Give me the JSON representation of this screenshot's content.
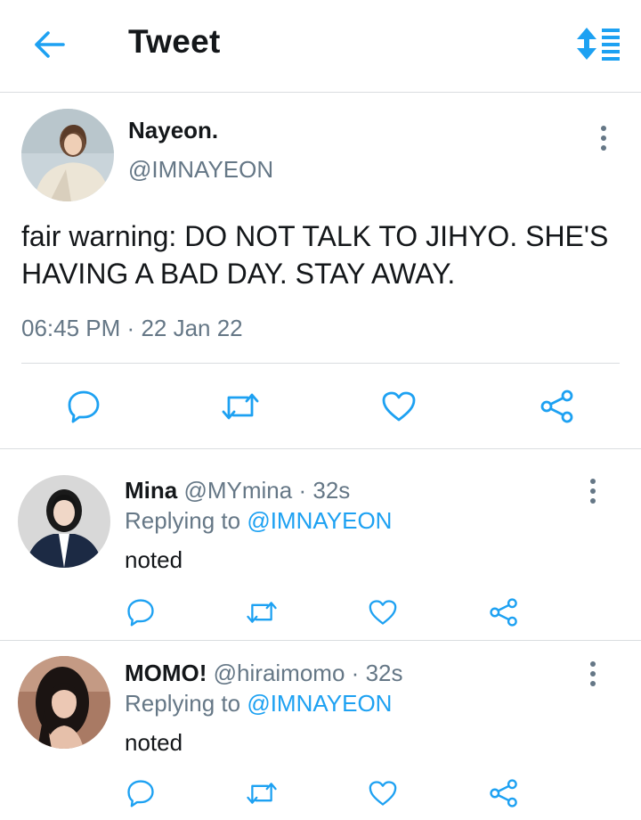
{
  "header": {
    "title": "Tweet",
    "back_icon": "arrow-left-icon",
    "sort_icon": "sort-list-icon",
    "accent_color": "#1da1f2"
  },
  "tweet": {
    "name": "Nayeon.",
    "handle": "@IMNAYEON",
    "text": "fair warning: DO NOT TALK TO JIHYO. SHE'S HAVING A BAD DAY. STAY AWAY.",
    "time": "06:45 PM",
    "separator": "·",
    "date": "22 Jan 22",
    "actions": [
      "reply-icon",
      "retweet-icon",
      "like-icon",
      "share-icon"
    ]
  },
  "replies": [
    {
      "name": "Mina",
      "handle": "@MYmina",
      "separator": "·",
      "time": "32s",
      "replying_label": "Replying to",
      "replying_to": "@IMNAYEON",
      "text": "noted"
    },
    {
      "name": "MOMO!",
      "handle": "@hiraimomo",
      "separator": "·",
      "time": "32s",
      "replying_label": "Replying to",
      "replying_to": "@IMNAYEON",
      "text": "noted"
    }
  ],
  "colors": {
    "text": "#14171a",
    "secondary": "#657786",
    "accent": "#1da1f2",
    "divider": "#dadde0"
  }
}
